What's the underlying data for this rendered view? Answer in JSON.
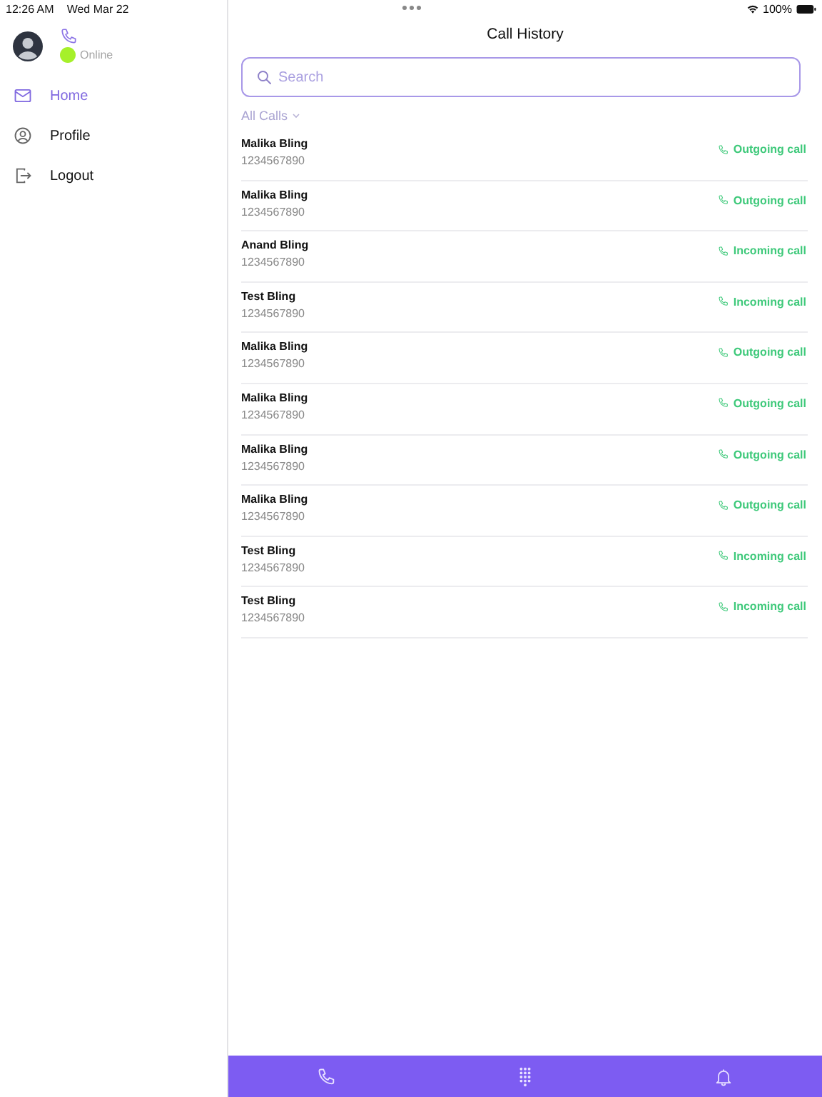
{
  "status_bar": {
    "time": "12:26 AM",
    "date": "Wed Mar 22",
    "battery": "100%"
  },
  "sidebar": {
    "status": "Online",
    "items": [
      {
        "label": "Home",
        "kind": "mail",
        "selected": true
      },
      {
        "label": "Profile",
        "kind": "person",
        "selected": false
      },
      {
        "label": "Logout",
        "kind": "logout",
        "selected": false
      }
    ]
  },
  "title": "Call History",
  "search": {
    "placeholder": "Search"
  },
  "filter": "All Calls",
  "calls": [
    {
      "name": "Malika Bling",
      "number": "1234567890",
      "type": "Outgoing call"
    },
    {
      "name": "Malika Bling",
      "number": "1234567890",
      "type": "Outgoing call"
    },
    {
      "name": "Anand Bling",
      "number": "1234567890",
      "type": "Incoming call"
    },
    {
      "name": "Test Bling",
      "number": "1234567890",
      "type": "Incoming call"
    },
    {
      "name": "Malika Bling",
      "number": "1234567890",
      "type": "Outgoing call"
    },
    {
      "name": "Malika Bling",
      "number": "1234567890",
      "type": "Outgoing call"
    },
    {
      "name": "Malika Bling",
      "number": "1234567890",
      "type": "Outgoing call"
    },
    {
      "name": "Malika Bling",
      "number": "1234567890",
      "type": "Outgoing call"
    },
    {
      "name": "Test Bling",
      "number": "1234567890",
      "type": "Incoming call"
    },
    {
      "name": "Test Bling",
      "number": "1234567890",
      "type": "Incoming call"
    }
  ]
}
